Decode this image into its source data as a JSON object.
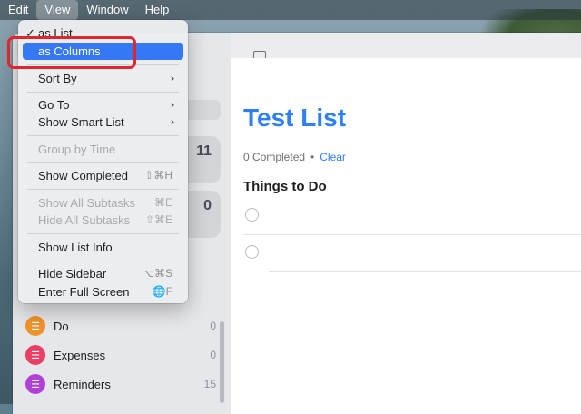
{
  "menubar": {
    "items": [
      "Edit",
      "View",
      "Window",
      "Help"
    ],
    "active_index": 1
  },
  "sidebar": {
    "tiles": [
      {
        "count": "11"
      },
      {
        "count": "0"
      }
    ],
    "lists": [
      {
        "name": "Do",
        "count": "0",
        "color": "#f0932b"
      },
      {
        "name": "Expenses",
        "count": "0",
        "color": "#ea3e63"
      },
      {
        "name": "Reminders",
        "count": "15",
        "color": "#b041d6"
      }
    ]
  },
  "main": {
    "title": "Test List",
    "completed_text": "0 Completed",
    "bullet": "•",
    "clear_label": "Clear",
    "section_title": "Things to Do"
  },
  "menu": {
    "as_list": "as List",
    "check": "✓",
    "as_columns": "as Columns",
    "sort_by": "Sort By",
    "go_to": "Go To",
    "show_smart_list": "Show Smart List",
    "group_by_time": "Group by Time",
    "show_completed": "Show Completed",
    "show_completed_sc": "⇧⌘H",
    "show_all_subtasks": "Show All Subtasks",
    "show_all_subtasks_sc": "⌘E",
    "hide_all_subtasks": "Hide All Subtasks",
    "hide_all_subtasks_sc": "⇧⌘E",
    "show_list_info": "Show List Info",
    "hide_sidebar": "Hide Sidebar",
    "hide_sidebar_sc": "⌥⌘S",
    "enter_full_screen": "Enter Full Screen",
    "enter_full_screen_sc": "🌐F",
    "submenu_arrow": "›"
  },
  "colors": {
    "accent": "#2f7ff7",
    "highlight": "#3478f6",
    "annotation": "#e0262c"
  }
}
